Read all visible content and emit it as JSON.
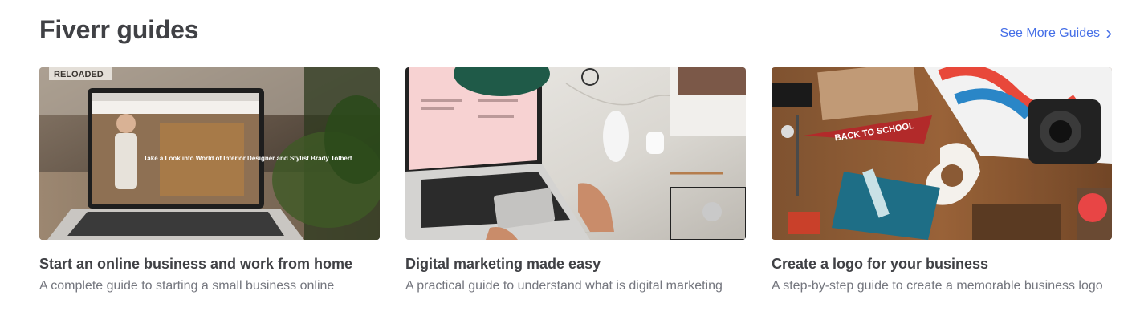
{
  "header": {
    "title": "Fiverr guides",
    "see_more_label": "See More Guides",
    "see_more_icon": "chevron-right-icon",
    "link_color": "#446ee7"
  },
  "guides": [
    {
      "title": "Start an online business and work from home",
      "description": "A complete guide to starting a small business online",
      "image": "laptop-on-desk-photo",
      "image_text": {
        "badge": "RELOADED",
        "headline": "Take a Look into World of Interior Designer and Stylist Brady Tolbert"
      }
    },
    {
      "title": "Digital marketing made easy",
      "description": "A practical guide to understand what is digital marketing",
      "image": "laptop-marble-desk-photo"
    },
    {
      "title": "Create a logo for your business",
      "description": "A step-by-step guide to create a memorable business logo",
      "image": "branding-flatlay-photo",
      "image_text": {
        "pennant": "BACK TO SCHOOL"
      }
    }
  ]
}
